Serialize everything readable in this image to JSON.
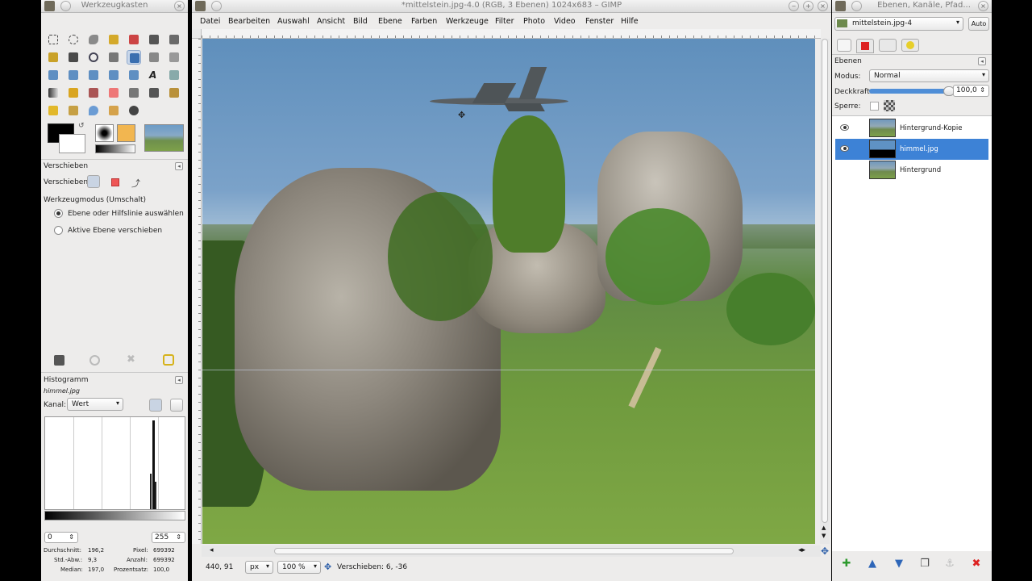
{
  "toolbox": {
    "title": "Werkzeugkasten",
    "options_panel": {
      "title": "Verschieben",
      "move_label": "Verschieben:",
      "mode_label": "Werkzeugmodus (Umschalt)",
      "radio1": "Ebene oder Hilfslinie auswählen",
      "radio2": "Aktive Ebene verschieben"
    },
    "histogram": {
      "title": "Histogramm",
      "layer": "himmel.jpg",
      "channel_label": "Kanal:",
      "channel_value": "Wert",
      "range_min": "0",
      "range_max": "255",
      "stats": {
        "mean_label": "Durchschnitt:",
        "mean": "196,2",
        "pixels_label": "Pixel:",
        "pixels": "699392",
        "std_label": "Std.-Abw.:",
        "std": "9,3",
        "count_label": "Anzahl:",
        "count": "699392",
        "median_label": "Median:",
        "median": "197,0",
        "percent_label": "Prozentsatz:",
        "percent": "100,0"
      }
    }
  },
  "image_window": {
    "title": "*mittelstein.jpg-4.0 (RGB, 3 Ebenen) 1024x683 – GIMP",
    "menu": [
      "Datei",
      "Bearbeiten",
      "Auswahl",
      "Ansicht",
      "Bild",
      "Ebene",
      "Farben",
      "Werkzeuge",
      "Filter",
      "Photo",
      "Video",
      "Fenster",
      "Hilfe"
    ],
    "status": {
      "coords": "440, 91",
      "unit": "px",
      "zoom": "100 %",
      "message": "Verschieben: 6, -36"
    }
  },
  "layers_window": {
    "title": "Ebenen, Kanäle, Pfad...",
    "image_select": "mittelstein.jpg-4",
    "auto_label": "Auto",
    "panel_title": "Ebenen",
    "mode_label": "Modus:",
    "mode_value": "Normal",
    "opacity_label": "Deckkraft:",
    "opacity_value": "100,0",
    "opacity_fraction": 1.0,
    "lock_label": "Sperre:",
    "layers": [
      {
        "name": "Hintergrund-Kopie",
        "visible": true,
        "selected": false
      },
      {
        "name": "himmel.jpg",
        "visible": true,
        "selected": true
      },
      {
        "name": "Hintergrund",
        "visible": false,
        "selected": false
      }
    ]
  },
  "colors": {
    "selection": "#3d82d6",
    "foreground": "#000000",
    "background": "#ffffff"
  }
}
